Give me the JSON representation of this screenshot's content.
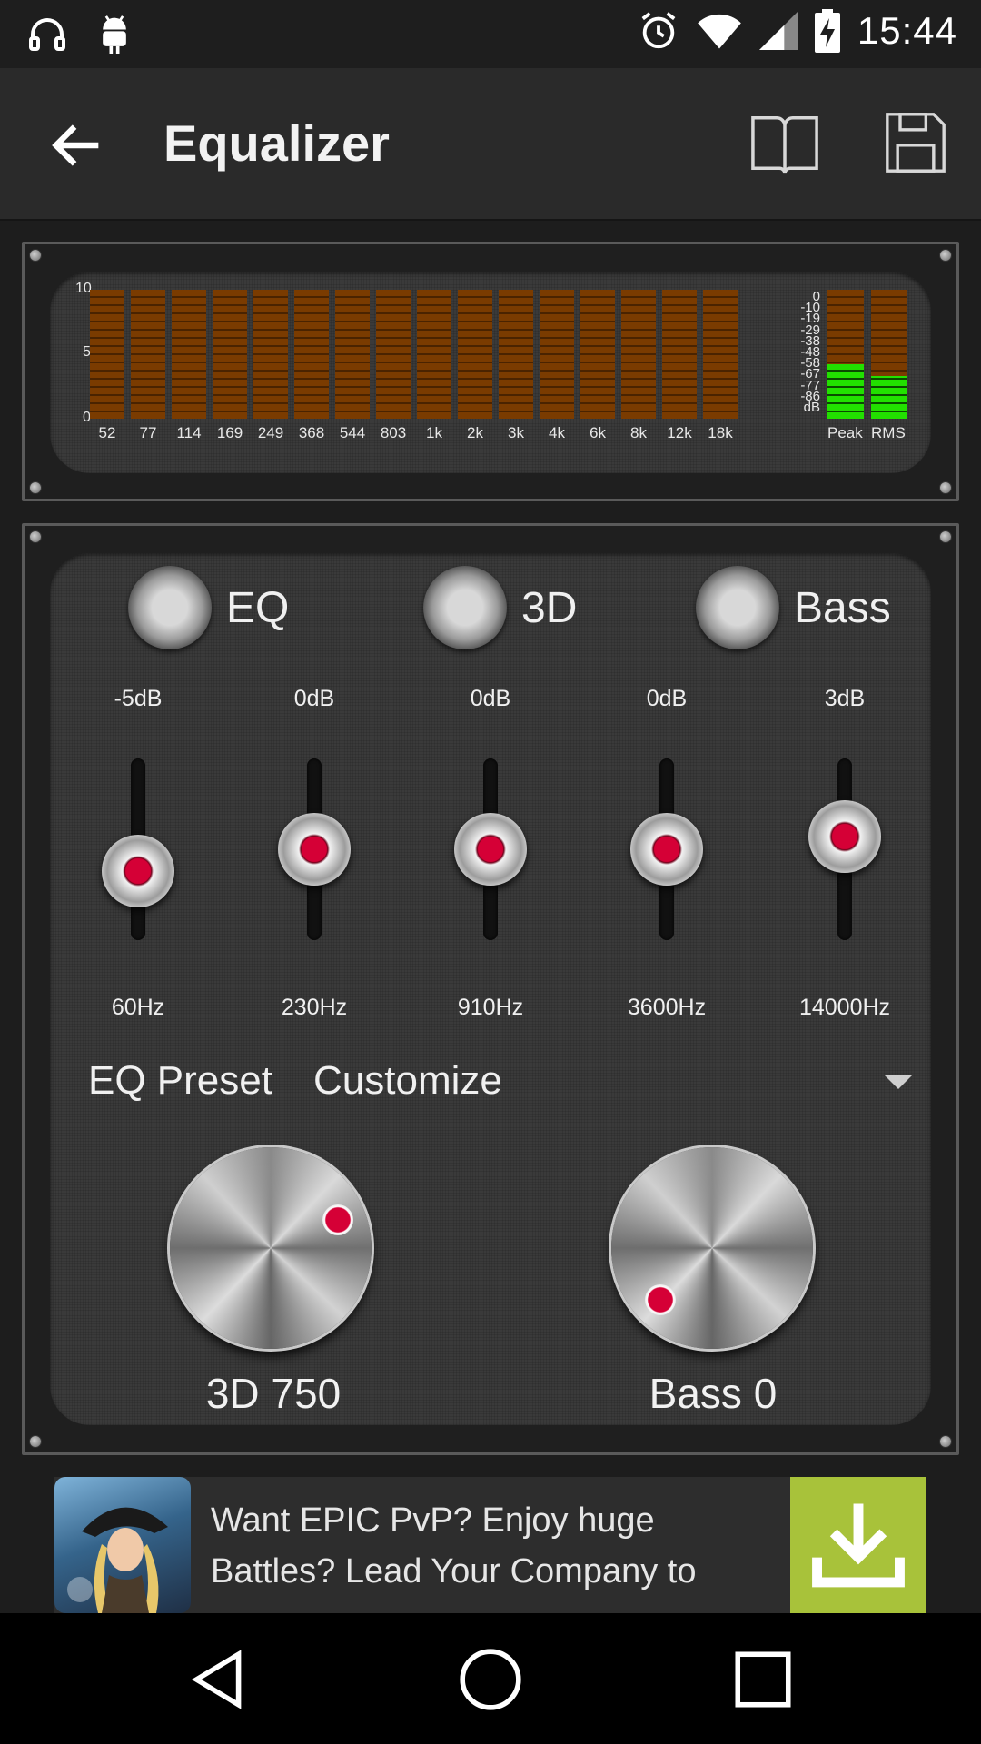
{
  "status_bar": {
    "time": "15:44"
  },
  "toolbar": {
    "title": "Equalizer"
  },
  "spectrum": {
    "y_ticks": [
      "10",
      "5",
      "0"
    ],
    "bands": [
      "52",
      "77",
      "114",
      "169",
      "249",
      "368",
      "544",
      "803",
      "1k",
      "2k",
      "3k",
      "4k",
      "6k",
      "8k",
      "12k",
      "18k"
    ],
    "db_ticks": [
      "0",
      "-10",
      "-19",
      "-29",
      "-38",
      "-48",
      "-58",
      "-67",
      "-77",
      "-86",
      "dB"
    ],
    "meter_labels": [
      "Peak",
      "RMS"
    ],
    "meter_levels": {
      "peak": 0.42,
      "rms": 0.33
    },
    "colors": {
      "band_off": "#7a3b00",
      "meter_on": "#22e000"
    }
  },
  "toggles": [
    {
      "label": "EQ"
    },
    {
      "label": "3D"
    },
    {
      "label": "Bass"
    }
  ],
  "sliders": [
    {
      "gain": "-5dB",
      "freq": "60Hz",
      "level": 0.38
    },
    {
      "gain": "0dB",
      "freq": "230Hz",
      "level": 0.5
    },
    {
      "gain": "0dB",
      "freq": "910Hz",
      "level": 0.5
    },
    {
      "gain": "0dB",
      "freq": "3600Hz",
      "level": 0.5
    },
    {
      "gain": "3dB",
      "freq": "14000Hz",
      "level": 0.57
    }
  ],
  "preset": {
    "label": "EQ Preset",
    "value": "Customize"
  },
  "knobs": [
    {
      "value_text": "3D 750",
      "level": 0.75
    },
    {
      "value_text": "Bass 0",
      "level": 0.0
    }
  ],
  "ad": {
    "text": "Want EPIC PvP? Enjoy huge Battles? Lead Your Company to"
  },
  "icons": [
    "headphones-icon",
    "android-icon",
    "alarm-icon",
    "wifi-icon",
    "signal-icon",
    "battery-charging-icon",
    "back-arrow-icon",
    "book-icon",
    "save-icon",
    "dropdown-arrow-icon",
    "download-icon",
    "nav-back-icon",
    "nav-home-icon",
    "nav-recents-icon"
  ]
}
